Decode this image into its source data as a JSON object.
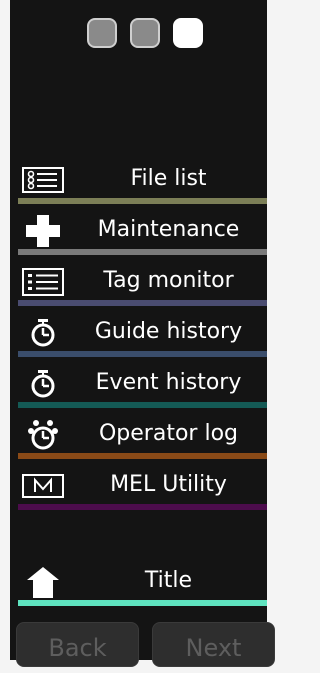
{
  "window_controls": [
    {
      "name": "control-1",
      "state": "inactive"
    },
    {
      "name": "control-2",
      "state": "inactive"
    },
    {
      "name": "control-3",
      "state": "active"
    }
  ],
  "menu": {
    "items": [
      {
        "label": "File list",
        "icon": "file-list-icon",
        "color": "#7c7f57"
      },
      {
        "label": "Maintenance",
        "icon": "maintenance-icon",
        "color": "#7a7a7a"
      },
      {
        "label": "Tag monitor",
        "icon": "tag-monitor-icon",
        "color": "#4a4c70"
      },
      {
        "label": "Guide history",
        "icon": "stopwatch-icon",
        "color": "#3a4d6b"
      },
      {
        "label": "Event history",
        "icon": "stopwatch-icon",
        "color": "#145a55"
      },
      {
        "label": "Operator log",
        "icon": "operator-log-icon",
        "color": "#8a4a17"
      },
      {
        "label": "MEL Utility",
        "icon": "mel-utility-icon",
        "color": "#4c0c4c"
      }
    ],
    "title_item": {
      "label": "Title",
      "icon": "home-icon",
      "color": "#5fe3bf"
    }
  },
  "nav": {
    "back_label": "Back",
    "next_label": "Next"
  }
}
